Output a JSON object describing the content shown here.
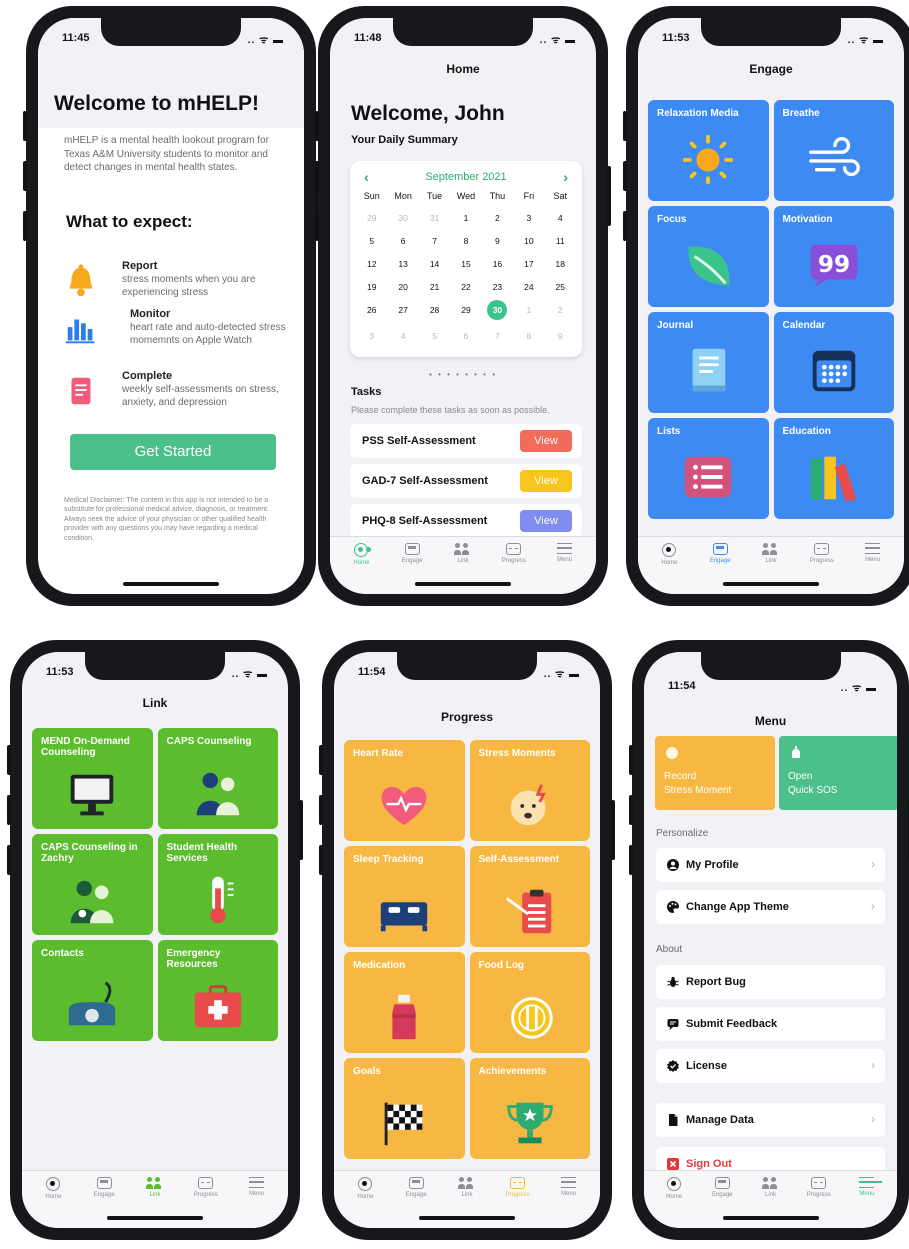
{
  "colors": {
    "home_accent": "#3bc48a",
    "engage_blue": "#3d8bf2",
    "link_green": "#5bbc2e",
    "progress_orange": "#f7b843",
    "menu_accent": "#3bc48a"
  },
  "tabs": [
    "Home",
    "Engage",
    "Link",
    "Progress",
    "Menu"
  ],
  "welcome_screen": {
    "time": "11:45",
    "title": "Welcome to mHELP!",
    "intro": "mHELP is a mental health lookout program for Texas A&M University students to monitor and detect changes in mental health states.",
    "expect_heading": "What to expect:",
    "features": [
      {
        "title": "Report",
        "desc": "stress moments when you are experiencing stress",
        "icon": "bell-icon"
      },
      {
        "title": "Monitor",
        "desc": "heart rate and auto-detected stress momemnts on Apple Watch",
        "icon": "bar-chart-icon"
      },
      {
        "title": "Complete",
        "desc": "weekly self-assessments on stress, anxiety, and depression",
        "icon": "document-icon"
      }
    ],
    "button": "Get Started",
    "disclaimer": "Medical Disclaimer: The content in this app is not intended to be a substitute for professional medical advice, diagnosis, or treatment. Always seek the advice of your physician or other qualified health provider with any questions you may have regarding a medical condition."
  },
  "home_screen": {
    "time": "11:48",
    "nav_title": "Home",
    "welcome": "Welcome, John",
    "summary": "Your Daily Summary",
    "calendar": {
      "month": "September 2021",
      "prev": "‹",
      "next": "›",
      "dows": [
        "Sun",
        "Mon",
        "Tue",
        "Wed",
        "Thu",
        "Fri",
        "Sat"
      ],
      "days": [
        [
          "29",
          "30",
          "31",
          "1",
          "2",
          "3",
          "4"
        ],
        [
          "5",
          "6",
          "7",
          "8",
          "9",
          "10",
          "11"
        ],
        [
          "12",
          "13",
          "14",
          "15",
          "16",
          "17",
          "18"
        ],
        [
          "19",
          "20",
          "21",
          "22",
          "23",
          "24",
          "25"
        ],
        [
          "26",
          "27",
          "28",
          "29",
          "30",
          "1",
          "2"
        ],
        [
          "3",
          "4",
          "5",
          "6",
          "7",
          "8",
          "9"
        ]
      ],
      "muted_first_row": 3,
      "muted_after_30": true,
      "selected": "30"
    },
    "pager": "▪ • • • • • • •",
    "tasks_heading": "Tasks",
    "tasks_desc": "Please complete these tasks as soon as possible.",
    "tasks": [
      {
        "title": "PSS Self-Assessment",
        "button": "View",
        "color": "#f26b5b"
      },
      {
        "title": "GAD-7 Self-Assessment",
        "button": "View",
        "color": "#f7c51e"
      },
      {
        "title": "PHQ-8 Self-Assessment",
        "button": "View",
        "color": "#7f8cf0"
      }
    ]
  },
  "engage_screen": {
    "time": "11:53",
    "nav_title": "Engage",
    "tiles": [
      {
        "label": "Relaxation Media",
        "icon": "sun-icon"
      },
      {
        "label": "Breathe",
        "icon": "wind-icon"
      },
      {
        "label": "Focus",
        "icon": "leaf-icon"
      },
      {
        "label": "Motivation",
        "icon": "quote-bubble-icon"
      },
      {
        "label": "Journal",
        "icon": "book-icon"
      },
      {
        "label": "Calendar",
        "icon": "calendar-icon"
      },
      {
        "label": "Lists",
        "icon": "list-icon"
      },
      {
        "label": "Education",
        "icon": "books-icon"
      }
    ]
  },
  "link_screen": {
    "time": "11:53",
    "nav_title": "Link",
    "tiles": [
      {
        "label": "MEND On-Demand Counseling",
        "icon": "monitor-icon"
      },
      {
        "label": "CAPS Counseling",
        "icon": "people-icon"
      },
      {
        "label": "CAPS Counseling in Zachry",
        "icon": "people-gear-icon"
      },
      {
        "label": "Student Health Services",
        "icon": "thermometer-icon"
      },
      {
        "label": "Contacts",
        "icon": "telephone-icon"
      },
      {
        "label": "Emergency Resources",
        "icon": "first-aid-kit-icon"
      }
    ]
  },
  "progress_screen": {
    "time": "11:54",
    "nav_title": "Progress",
    "tiles": [
      {
        "label": "Heart Rate",
        "icon": "heart-pulse-icon"
      },
      {
        "label": "Stress Moments",
        "icon": "stressed-face-icon"
      },
      {
        "label": "Sleep Tracking",
        "icon": "bed-icon"
      },
      {
        "label": "Self-Assessment",
        "icon": "clipboard-icon"
      },
      {
        "label": "Medication",
        "icon": "medicine-bottle-icon"
      },
      {
        "label": "Food Log",
        "icon": "plate-utensils-icon"
      },
      {
        "label": "Goals",
        "icon": "checkered-flag-icon"
      },
      {
        "label": "Achievements",
        "icon": "trophy-icon"
      }
    ]
  },
  "menu_screen": {
    "time": "11:54",
    "nav_title": "Menu",
    "quick_actions": [
      {
        "line1": "Record",
        "line2": "Stress Moment",
        "color": "#f7b843"
      },
      {
        "line1": "Open",
        "line2": "Quick SOS",
        "color": "#4dbf8a"
      }
    ],
    "personalize_heading": "Personalize",
    "about_heading": "About",
    "personalize_items": [
      {
        "label": "My Profile",
        "icon": "person-icon"
      },
      {
        "label": "Change App Theme",
        "icon": "palette-icon"
      }
    ],
    "about_items": [
      {
        "label": "Report Bug",
        "icon": "bug-icon"
      },
      {
        "label": "Submit Feedback",
        "icon": "feedback-icon"
      },
      {
        "label": "License",
        "icon": "badge-check-icon"
      }
    ],
    "data_item": {
      "label": "Manage Data",
      "icon": "file-icon"
    },
    "signout": "Sign Out",
    "chevron": "›"
  },
  "status_icons": ".. ᯤ ▬"
}
